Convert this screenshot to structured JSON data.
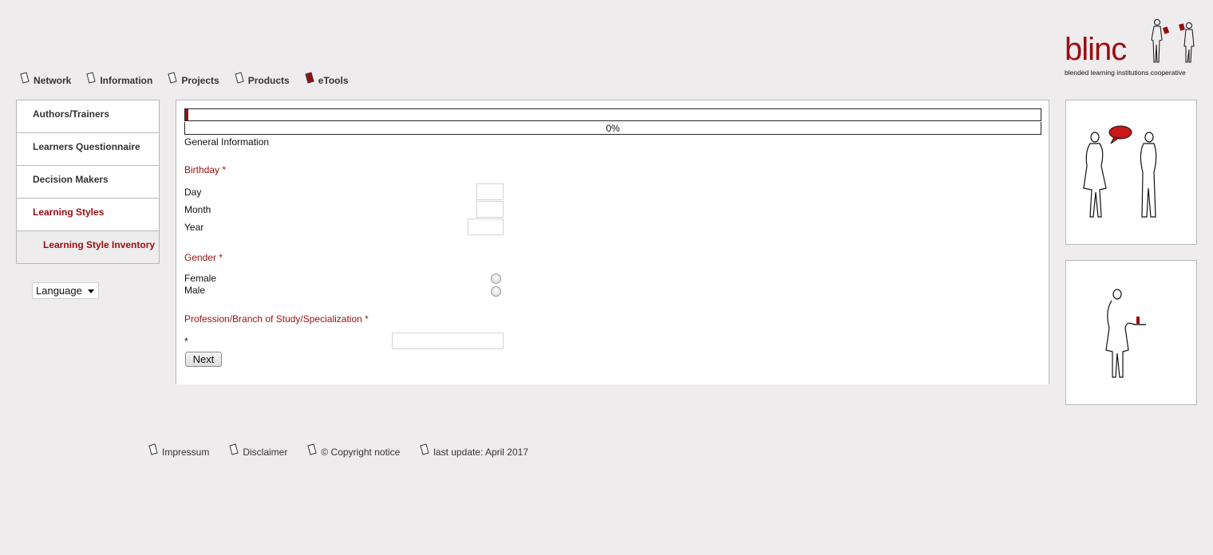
{
  "top_nav": [
    {
      "label": "Network",
      "icon": "document-icon"
    },
    {
      "label": "Information",
      "icon": "document-icon"
    },
    {
      "label": "Projects",
      "icon": "document-icon"
    },
    {
      "label": "Products",
      "icon": "document-icon"
    },
    {
      "label": "eTools",
      "icon": "red-document-icon"
    }
  ],
  "logo": {
    "text": "blinc",
    "subtitle": "blended learning institutions cooperative"
  },
  "sidebar": {
    "items": [
      {
        "label": "Authors/Trainers"
      },
      {
        "label": "Learners Questionnaire"
      },
      {
        "label": "Decision Makers"
      },
      {
        "label": "Learning Styles"
      },
      {
        "label": "Learning Style Inventory"
      }
    ]
  },
  "language": {
    "label": "Language"
  },
  "form": {
    "progress_text": "0%",
    "progress_value": 0,
    "section_title": "General Information",
    "birthday": {
      "label": "Birthday *",
      "day_label": "Day",
      "month_label": "Month",
      "year_label": "Year",
      "day_value": "",
      "month_value": "",
      "year_value": ""
    },
    "gender": {
      "label": "Gender *",
      "female_label": "Female",
      "male_label": "Male"
    },
    "profession": {
      "label": "Profession/Branch of Study/Specialization *",
      "field_label": "*",
      "value": ""
    },
    "next_label": "Next"
  },
  "footer": [
    {
      "label": "Impressum"
    },
    {
      "label": "Disclaimer"
    },
    {
      "label": "© Copyright notice"
    },
    {
      "label": "last update: April 2017"
    }
  ],
  "colors": {
    "accent": "#9b0e10",
    "background": "#eeeced",
    "border": "#b8b8b8"
  }
}
